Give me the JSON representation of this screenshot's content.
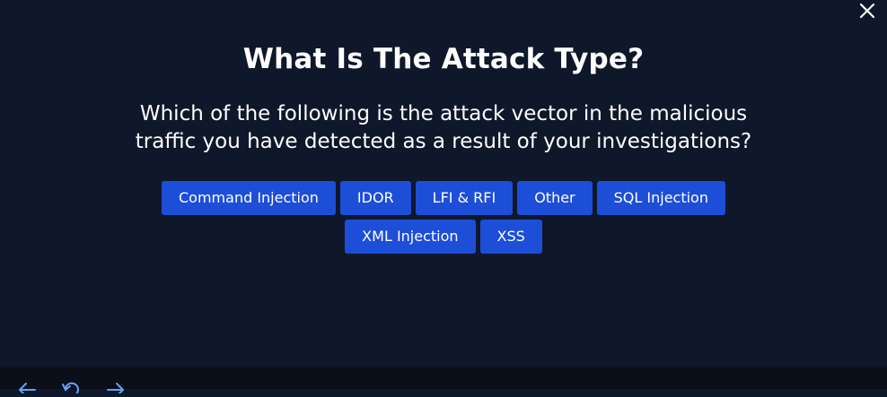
{
  "dialog": {
    "title": "What Is The Attack Type?",
    "question_line1": "Which of the following is the attack vector in the malicious",
    "question_line2": "traffic you have detected as a result of your investigations?",
    "options_row1": [
      "Command Injection",
      "IDOR",
      "LFI & RFI",
      "Other",
      "SQL Injection"
    ],
    "options_row2": [
      "XML Injection",
      "XSS"
    ]
  },
  "icons": {
    "close": "close-icon",
    "back": "arrow-left-icon",
    "reload": "refresh-icon",
    "forward": "arrow-right-icon"
  },
  "colors": {
    "background": "#0f172a",
    "button": "#1d4ed8",
    "bottom_bar": "#0a0f19",
    "icon": "#60a5fa"
  }
}
